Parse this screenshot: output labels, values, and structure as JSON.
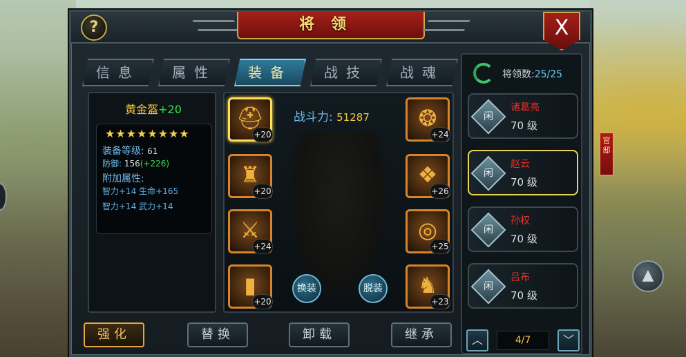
{
  "header": {
    "help": "?",
    "title": "将领",
    "close": "X"
  },
  "background": {
    "banner_text": "官 邸"
  },
  "tabs": [
    {
      "label": "信息",
      "active": false
    },
    {
      "label": "属性",
      "active": false
    },
    {
      "label": "装备",
      "active": true
    },
    {
      "label": "战技",
      "active": false
    },
    {
      "label": "战魂",
      "active": false
    }
  ],
  "item": {
    "name": "黄金盔",
    "plus": "+20",
    "stars": "★★★★★★★★",
    "level_label": "装备等级",
    "level_value": "61",
    "defense_label": "防御",
    "defense_value": "156",
    "defense_bonus": "(+226)",
    "extra_label": "附加属性:",
    "extra_line1": "智力+14  生命+165",
    "extra_line2": "智力+14  武力+14"
  },
  "equipment": {
    "power_label": "战斗力:",
    "power_value": "51287",
    "left_slots": [
      {
        "icon": "helmet-icon",
        "level": "+20"
      },
      {
        "icon": "armor-icon",
        "level": "+20"
      },
      {
        "icon": "weapon-icon",
        "level": "+24"
      },
      {
        "icon": "boots-icon",
        "level": "+20"
      }
    ],
    "right_slots": [
      {
        "icon": "amulet-icon",
        "level": "+24"
      },
      {
        "icon": "tiger-token-icon",
        "level": "+26"
      },
      {
        "icon": "ring-icon",
        "level": "+25"
      },
      {
        "icon": "horse-icon",
        "level": "+23"
      }
    ],
    "swap_label": "换装",
    "remove_label": "脱装"
  },
  "bottom_buttons": [
    {
      "label": "强化",
      "active": true
    },
    {
      "label": "替换",
      "active": false
    },
    {
      "label": "卸载",
      "active": false
    },
    {
      "label": "继承",
      "active": false
    }
  ],
  "heroes_panel": {
    "count_label": "将领数:",
    "count_value": "25/25",
    "heroes": [
      {
        "status": "闲",
        "name": "诸葛亮",
        "level": "70 级",
        "selected": false
      },
      {
        "status": "闲",
        "name": "赵云",
        "level": "70 级",
        "selected": true
      },
      {
        "status": "闲",
        "name": "孙权",
        "level": "70 级",
        "selected": false
      },
      {
        "status": "闲",
        "name": "吕布",
        "level": "70 级",
        "selected": false
      }
    ],
    "page": "4/7"
  }
}
